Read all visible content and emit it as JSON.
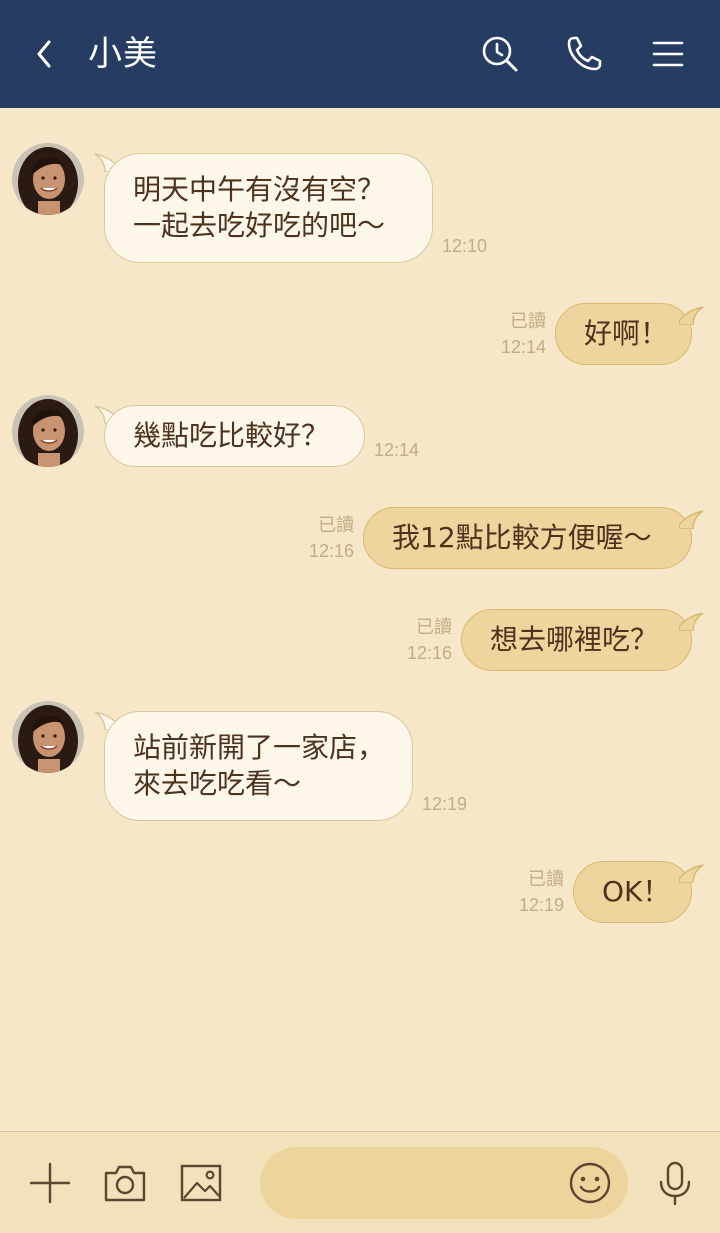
{
  "header": {
    "title": "小美",
    "bg_color": "#273c63"
  },
  "messages": [
    {
      "from": "friend",
      "lines": [
        "明天中午有沒有空？",
        "一起去吃好吃的吧～"
      ],
      "time": "12:10"
    },
    {
      "from": "me",
      "text": "好啊！",
      "read": "已讀",
      "time": "12:14"
    },
    {
      "from": "friend",
      "lines": [
        "幾點吃比較好？"
      ],
      "time": "12:14"
    },
    {
      "from": "me",
      "text": "我12點比較方便喔～",
      "read": "已讀",
      "time": "12:16"
    },
    {
      "from": "me",
      "text": "想去哪裡吃？",
      "read": "已讀",
      "time": "12:16"
    },
    {
      "from": "friend",
      "lines": [
        "站前新開了一家店，",
        "來去吃吃看～"
      ],
      "time": "12:19"
    },
    {
      "from": "me",
      "text": "OK！",
      "read": "已讀",
      "time": "12:19"
    }
  ],
  "composer": {
    "value": "",
    "placeholder": ""
  },
  "colors": {
    "background": "#f5e7c7",
    "incoming_bubble": "#fdf7ea",
    "outgoing_bubble": "#eed59e",
    "text": "#4d331d",
    "meta_text": "#c1ad86"
  },
  "icons": {
    "back": "chevron-left-icon",
    "search": "search-clock-icon",
    "call": "phone-icon",
    "menu": "hamburger-menu-icon",
    "add": "plus-icon",
    "camera": "camera-icon",
    "image": "image-icon",
    "emoji": "smiley-icon",
    "voice": "microphone-icon"
  }
}
